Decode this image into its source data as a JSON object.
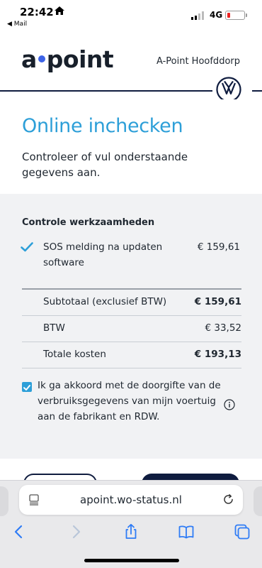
{
  "status_bar": {
    "time": "22:42",
    "back_app": "◀ Mail",
    "network": "4G"
  },
  "header": {
    "logo_left": "a",
    "logo_right": "point",
    "dealer_name": "A-Point Hoofddorp"
  },
  "intro": {
    "title": "Online inchecken",
    "subtitle": "Controleer of vul onderstaande gegevens aan."
  },
  "work": {
    "section_title": "Controle werkzaamheden",
    "items": [
      {
        "label": "SOS melding na updaten software",
        "price": "€ 159,61",
        "checked": true
      }
    ]
  },
  "totals": {
    "subtotal_label": "Subtotaal (exclusief BTW)",
    "subtotal_value": "€ 159,61",
    "vat_label": "BTW",
    "vat_value": "€ 33,52",
    "total_label": "Totale kosten",
    "total_value": "€ 193,13"
  },
  "consent": {
    "checked": true,
    "text": "Ik ga akkoord met de doorgifte van de verbruiksgegevens van mijn voertuig aan de fabrikant en RDW."
  },
  "browser": {
    "url": "apoint.wo-status.nl"
  },
  "colors": {
    "accent": "#2d9fd8",
    "navy": "#0f1c3f",
    "logo_dot": "#3d63e6",
    "panel_bg": "#f1f2f4",
    "battery_low": "#e22222"
  }
}
